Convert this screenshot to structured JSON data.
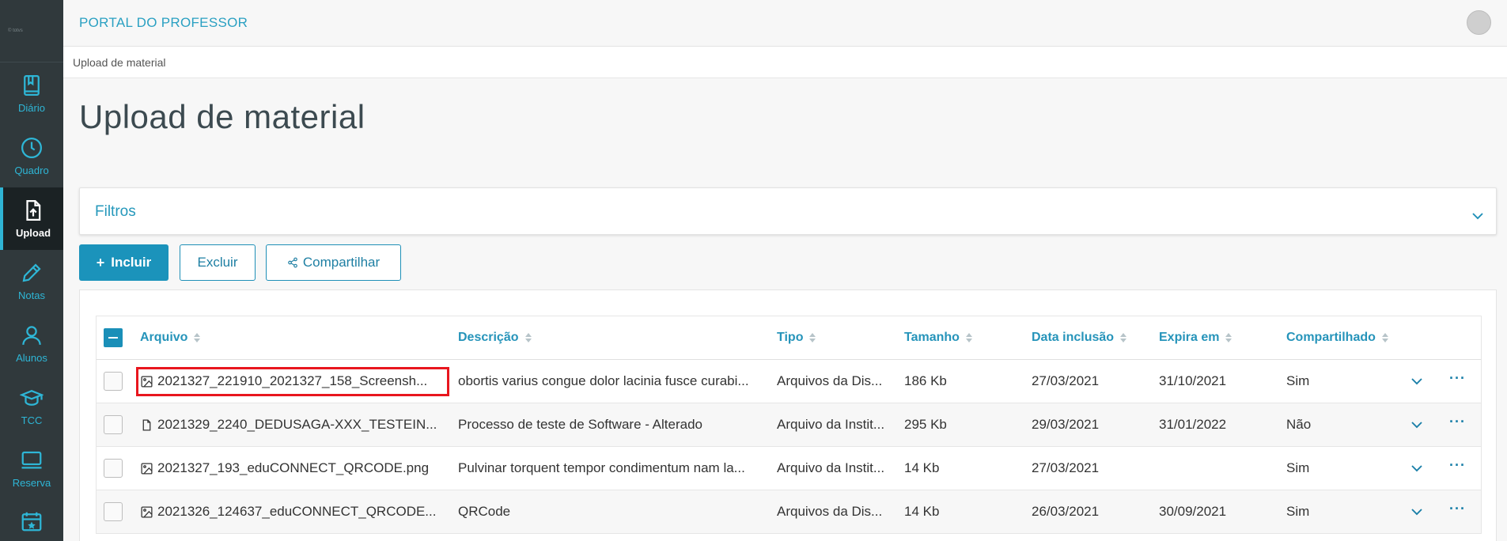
{
  "sidebar": {
    "logo_text": "© totvs",
    "items": [
      {
        "label": "Diário",
        "icon": "book-icon"
      },
      {
        "label": "Quadro",
        "icon": "clock-icon"
      },
      {
        "label": "Upload",
        "icon": "upload-file-icon",
        "active": true
      },
      {
        "label": "Notas",
        "icon": "pencil-icon"
      },
      {
        "label": "Alunos",
        "icon": "user-icon"
      },
      {
        "label": "TCC",
        "icon": "graduation-cap-icon"
      },
      {
        "label": "Reserva",
        "icon": "monitor-icon"
      }
    ]
  },
  "header": {
    "brand": "PORTAL DO PROFESSOR",
    "breadcrumb": "Upload de material"
  },
  "page": {
    "title": "Upload de material",
    "filter_label": "Filtros"
  },
  "toolbar": {
    "include_label": "Incluir",
    "delete_label": "Excluir",
    "share_label": "Compartilhar"
  },
  "table": {
    "columns": [
      "Arquivo",
      "Descrição",
      "Tipo",
      "Tamanho",
      "Data inclusão",
      "Expira em",
      "Compartilhado"
    ],
    "rows": [
      {
        "file": "2021327_221910_2021327_158_Screensh...",
        "file_icon": "image-icon",
        "description": "obortis varius congue dolor lacinia fusce curabi...",
        "type": "Arquivos da Dis...",
        "size": "186 Kb",
        "date": "27/03/2021",
        "expires": "31/10/2021",
        "shared": "Sim"
      },
      {
        "file": "2021329_2240_DEDUSAGA-XXX_TESTEIN...",
        "file_icon": "document-icon",
        "description": "Processo de teste de Software - Alterado",
        "type": "Arquivo da Instit...",
        "size": "295 Kb",
        "date": "29/03/2021",
        "expires": "31/01/2022",
        "shared": "Não"
      },
      {
        "file": "2021327_193_eduCONNECT_QRCODE.png",
        "file_icon": "image-icon",
        "description": "Pulvinar torquent tempor condimentum nam la...",
        "type": "Arquivo da Instit...",
        "size": "14 Kb",
        "date": "27/03/2021",
        "expires": "",
        "shared": "Sim"
      },
      {
        "file": "2021326_124637_eduCONNECT_QRCODE...",
        "file_icon": "image-icon",
        "description": "QRCode",
        "type": "Arquivos da Dis...",
        "size": "14 Kb",
        "date": "26/03/2021",
        "expires": "30/09/2021",
        "shared": "Sim"
      }
    ]
  },
  "colors": {
    "accent": "#1b93bb",
    "sidebar_bg": "#30393c",
    "highlight": "#e8161e"
  }
}
